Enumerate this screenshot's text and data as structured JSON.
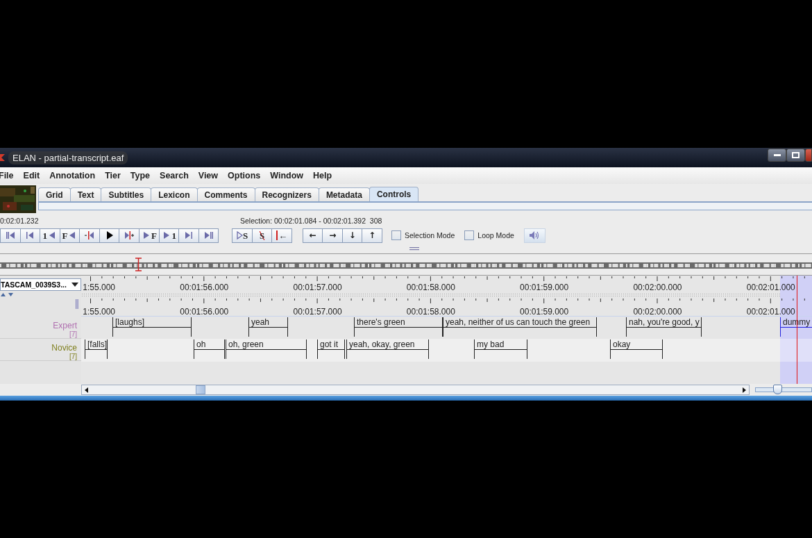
{
  "window": {
    "title": "ELAN - partial-transcript.eaf"
  },
  "menu": [
    "File",
    "Edit",
    "Annotation",
    "Tier",
    "Type",
    "Search",
    "View",
    "Options",
    "Window",
    "Help"
  ],
  "video_thumbnail": {
    "kind": "picture"
  },
  "tabs": [
    {
      "label": "Grid",
      "selected": false
    },
    {
      "label": "Text",
      "selected": false
    },
    {
      "label": "Subtitles",
      "selected": false
    },
    {
      "label": "Lexicon",
      "selected": false
    },
    {
      "label": "Comments",
      "selected": false
    },
    {
      "label": "Recognizers",
      "selected": false
    },
    {
      "label": "Metadata",
      "selected": false
    },
    {
      "label": "Controls",
      "selected": true
    }
  ],
  "media_time": "0:02:01.232",
  "selection": {
    "label": "Selection:",
    "begin": "00:02:01.084",
    "separator": "-",
    "end": "00:02:01.392",
    "duration": "308"
  },
  "player_buttons": [
    {
      "kind": "begin"
    },
    {
      "kind": "prev"
    },
    {
      "kind": "back-second",
      "label": "1"
    },
    {
      "kind": "back-frame",
      "label": "F"
    },
    {
      "kind": "back-pixel"
    },
    {
      "kind": "play"
    },
    {
      "kind": "fwd-pixel"
    },
    {
      "kind": "fwd-frame",
      "label": "F"
    },
    {
      "kind": "fwd-second",
      "label": "1"
    },
    {
      "kind": "next"
    },
    {
      "kind": "end"
    }
  ],
  "selection_buttons": [
    {
      "kind": "play-selection",
      "label": "S"
    },
    {
      "kind": "clear-selection",
      "label": "S"
    },
    {
      "kind": "to-selection-begin",
      "label": "←"
    }
  ],
  "arrow_buttons": [
    "←",
    "→",
    "↓",
    "↑"
  ],
  "checkboxes": [
    {
      "label": "Selection Mode",
      "checked": false
    },
    {
      "label": "Loop Mode",
      "checked": false
    }
  ],
  "media_selector": {
    "value": "TASCAM_0039S3..."
  },
  "ruler_labels": [
    "1:55.000",
    "00:01:56.000",
    "00:01:57.000",
    "00:01:58.000",
    "00:01:59.000",
    "00:02:00.000",
    "00:02:01.000"
  ],
  "ruler2_labels": [
    "1:55.000",
    "00:01:56.000",
    "00:01:57.000",
    "00:01:58.000",
    "00:01:59.000",
    "00:02:00.000",
    "00:02:01.000"
  ],
  "tiers": [
    {
      "name": "Expert",
      "count": "[7]",
      "color": "#b070b0",
      "annotations": [
        {
          "text": "[laughs]",
          "selected": false
        },
        {
          "text": "yeah",
          "selected": false
        },
        {
          "text": "there's green",
          "selected": false
        },
        {
          "text": "yeah, neither of us can touch the green",
          "selected": false
        },
        {
          "text": "nah, you're good, y",
          "selected": false
        },
        {
          "text": "dummy",
          "selected": true
        }
      ]
    },
    {
      "name": "Novice",
      "count": "[7]",
      "color": "#808020",
      "annotations": [
        {
          "text": "[falls]",
          "selected": false
        },
        {
          "text": "oh",
          "selected": false
        },
        {
          "text": "oh, green",
          "selected": false
        },
        {
          "text": "got it",
          "selected": false
        },
        {
          "text": "yeah, okay, green",
          "selected": false
        },
        {
          "text": "my bad",
          "selected": false
        },
        {
          "text": "okay",
          "selected": false
        }
      ]
    }
  ],
  "zoom_slider": {
    "level": 0.39
  }
}
